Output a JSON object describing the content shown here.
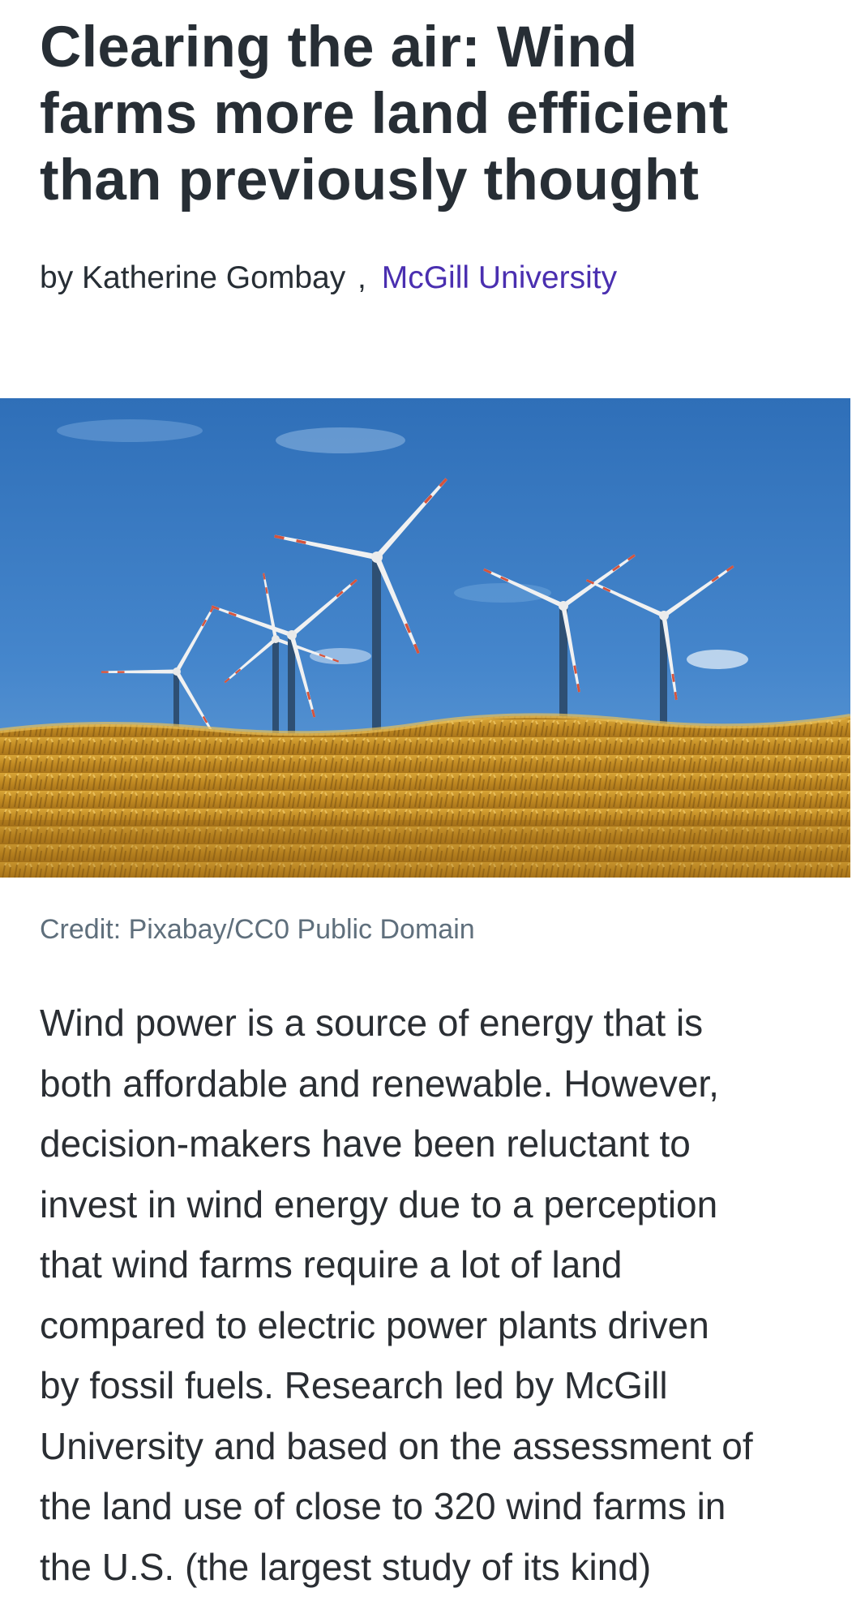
{
  "article": {
    "headline_lines": [
      "Clearing the air: Wind",
      "farms more land efficient",
      "than previously thought"
    ],
    "byline": {
      "prefix": "by Katherine Gombay",
      "separator": ",",
      "affiliation": "McGill University"
    },
    "image": {
      "subject": "wind turbines above a golden wheat field under a blue sky"
    },
    "caption": "Credit: Pixabay/CC0 Public Domain",
    "body_lines": [
      "Wind power is a source of energy that is",
      "both affordable and renewable. However,",
      "decision-makers have been reluctant to",
      "invest in wind energy due to a perception",
      "that wind farms require a lot of land",
      "compared to electric power plants driven",
      "by fossil fuels. Research led by McGill",
      "University and based on the assessment of",
      "the land use of close to 320 wind farms in",
      "the U.S. (the largest study of its kind)"
    ]
  },
  "colors": {
    "headline": "#272e35",
    "link": "#4a2fb0",
    "caption": "#5f6f7c",
    "sky": "#3f7fc7",
    "wheat": "#c9952b"
  }
}
